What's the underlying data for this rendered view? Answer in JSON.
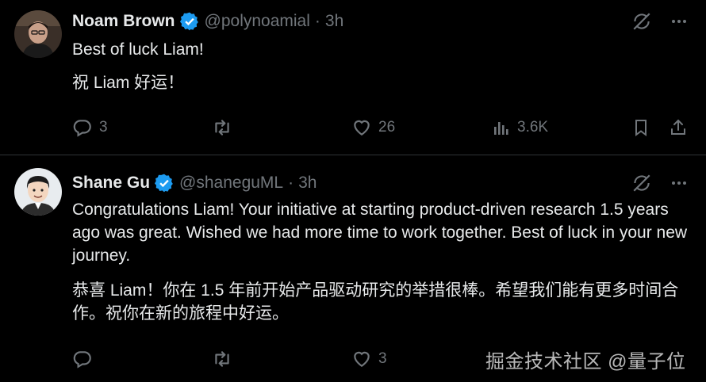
{
  "tweets": [
    {
      "author_name": "Noam Brown",
      "author_handle": "@polynoamial",
      "separator": "·",
      "time": "3h",
      "text_lines": [
        "Best of luck Liam!",
        "祝 Liam 好运！"
      ],
      "actions": {
        "replies": "3",
        "reposts": "",
        "likes": "26",
        "views": "3.6K"
      }
    },
    {
      "author_name": "Shane Gu",
      "author_handle": "@shaneguML",
      "separator": "·",
      "time": "3h",
      "text_paragraphs": [
        "Congratulations Liam! Your initiative at starting product-driven research 1.5 years ago was great. Wished we had more time to work together. Best of luck in your new journey.",
        "恭喜 Liam！你在 1.5 年前开始产品驱动研究的举措很棒。希望我们能有更多时间合作。祝你在新的旅程中好运。"
      ],
      "actions": {
        "replies": "",
        "reposts": "",
        "likes": "3"
      }
    }
  ],
  "watermark": "掘金技术社区 @量子位",
  "colors": {
    "background": "#000000",
    "text": "#e7e9ea",
    "muted": "#71767b",
    "verified": "#1d9bf0",
    "divider": "#2f3336"
  },
  "icons": [
    "grok-icon",
    "more-icon",
    "reply-icon",
    "repost-icon",
    "like-icon",
    "views-icon",
    "bookmark-icon",
    "share-icon",
    "verified-badge-icon"
  ]
}
